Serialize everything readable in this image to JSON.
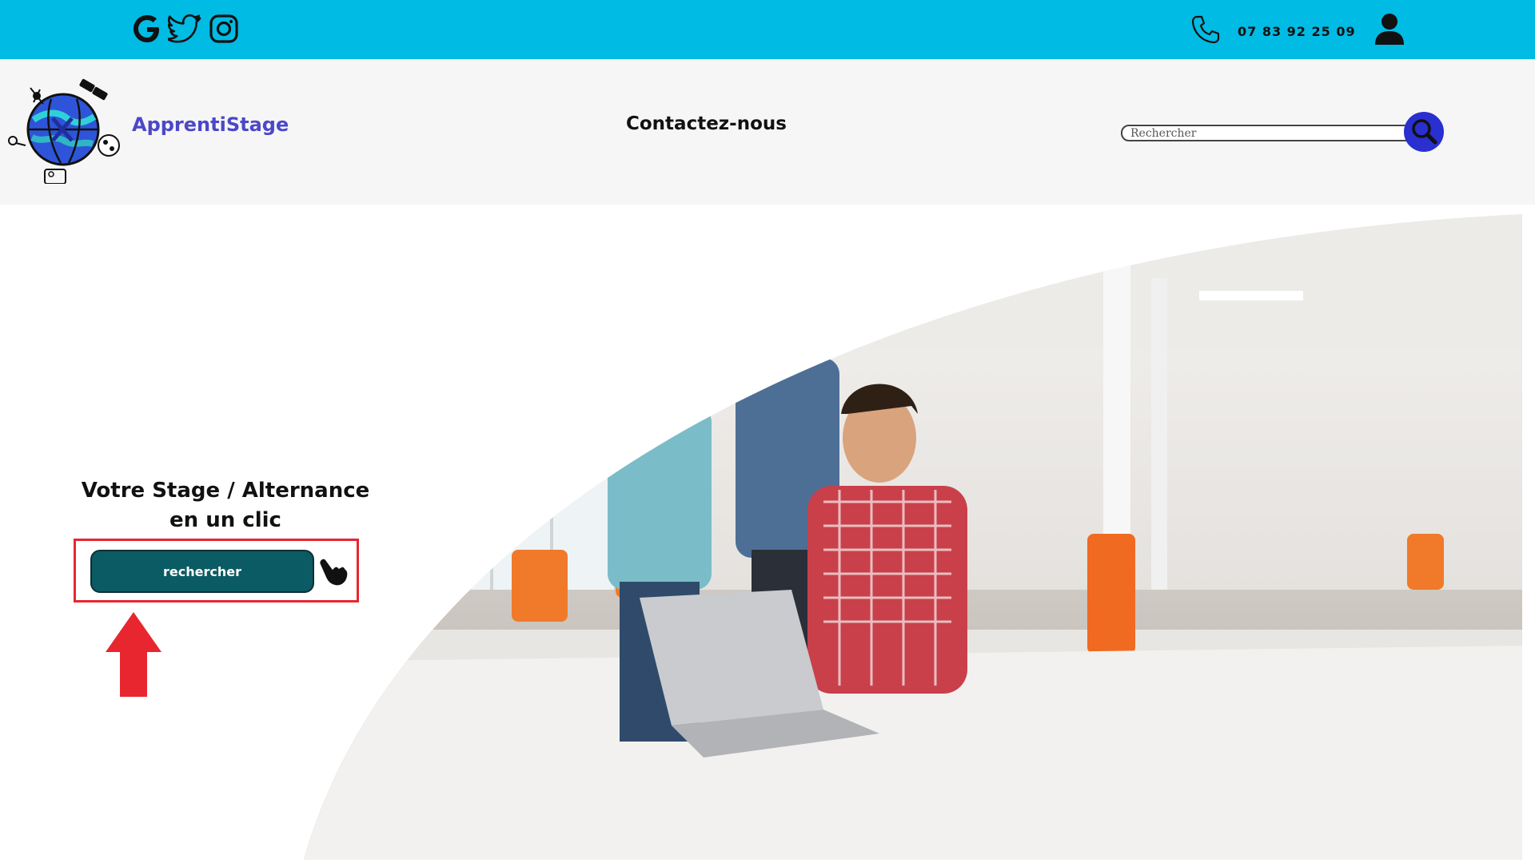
{
  "topbar": {
    "bg_color": "#00bbe3",
    "social_icons": [
      "google-icon",
      "twitter-icon",
      "instagram-icon"
    ],
    "phone_icon": "phone-icon",
    "phone_number": "07 83 92 25 09",
    "user_icon": "user-icon"
  },
  "header": {
    "brand_name": "ApprentiStage",
    "brand_color": "#4b48c9",
    "nav_contact": "Contactez-nous",
    "search_placeholder": "Rechercher",
    "search_button_icon": "search-icon",
    "search_button_color": "#2a2fcf"
  },
  "hero": {
    "tagline_line1": "Votre Stage / Alternance",
    "tagline_line2": "en un clic",
    "cta_label": "rechercher",
    "cta_color": "#0a5b63",
    "highlight_color": "#e8262f",
    "pointer_icon": "pointing-hand-icon",
    "arrow_icon": "red-up-arrow-icon",
    "photo": "office-team-photo"
  }
}
